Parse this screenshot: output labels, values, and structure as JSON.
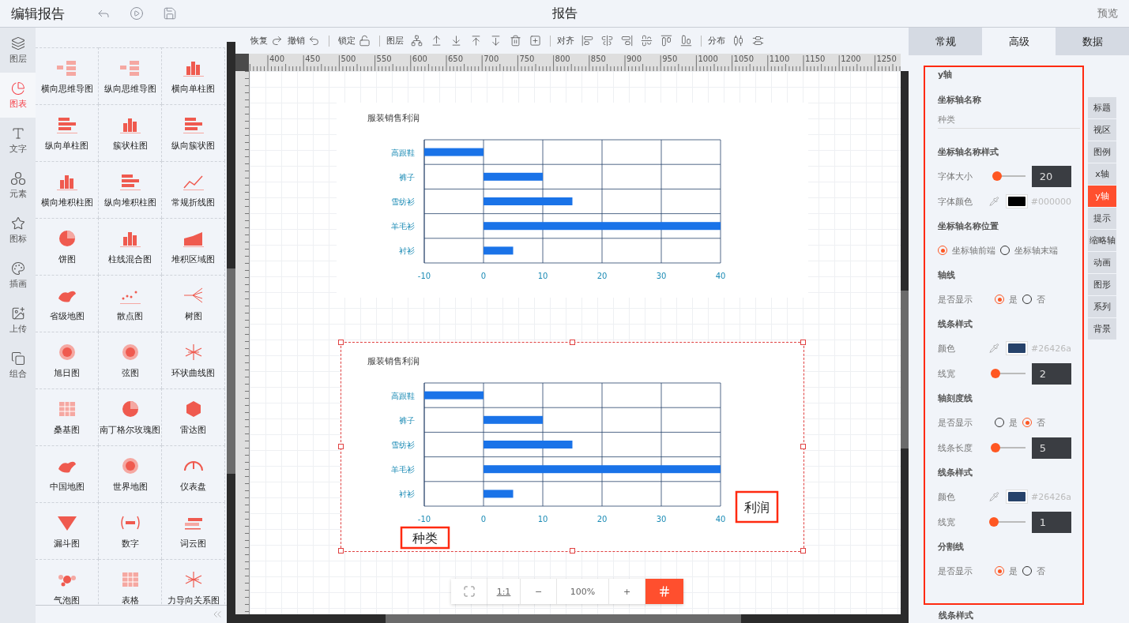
{
  "topbar": {
    "title": "编辑报告",
    "center_title": "报告",
    "preview": "预览"
  },
  "rail": [
    {
      "label": "图层",
      "selected": false
    },
    {
      "label": "图表",
      "selected": true
    },
    {
      "label": "文字",
      "selected": false
    },
    {
      "label": "元素",
      "selected": false
    },
    {
      "label": "图标",
      "selected": false
    },
    {
      "label": "插画",
      "selected": false
    },
    {
      "label": "上传",
      "selected": false
    },
    {
      "label": "组合",
      "selected": false
    }
  ],
  "palette": [
    "横向思维导图",
    "纵向思维导图",
    "横向单柱图",
    "纵向单柱图",
    "簇状柱图",
    "纵向簇状图",
    "横向堆积柱图",
    "纵向堆积柱图",
    "常规折线图",
    "饼图",
    "柱线混合图",
    "堆积区域图",
    "省级地图",
    "散点图",
    "树图",
    "旭日图",
    "弦图",
    "环状曲线图",
    "桑基图",
    "南丁格尔玫瑰图",
    "雷达图",
    "中国地图",
    "世界地图",
    "仪表盘",
    "漏斗图",
    "数字",
    "词云图",
    "气泡图",
    "表格",
    "力导向关系图"
  ],
  "toolbar": [
    {
      "label": "恢复"
    },
    {
      "label": "撤销"
    },
    {
      "label": "锁定"
    },
    {
      "label": "图层"
    },
    {
      "label": "对齐"
    },
    {
      "label": "分布"
    }
  ],
  "ruler": [
    "400",
    "450",
    "500",
    "550",
    "600",
    "650",
    "700",
    "750",
    "800",
    "850",
    "900",
    "950",
    "1000",
    "1050",
    "1100",
    "1150",
    "1200",
    "1250"
  ],
  "charts": [
    {
      "selected": false,
      "chart_data": {
        "type": "bar",
        "orientation": "horizontal",
        "grid": true,
        "title": "服装销售利润",
        "categories": [
          "高跟鞋",
          "裤子",
          "雪纺衫",
          "羊毛衫",
          "衬衫"
        ],
        "series": [
          {
            "color": "#1a73e8",
            "values": [
              -10,
              10,
              15,
              40,
              5
            ]
          }
        ],
        "xlim": [
          -10,
          40
        ],
        "xticks": [
          -10,
          0,
          10,
          20,
          30,
          40
        ]
      }
    },
    {
      "selected": true,
      "axis_names": {
        "category_axis": "种类",
        "value_axis": "利润"
      },
      "chart_data": {
        "type": "bar",
        "orientation": "horizontal",
        "grid": true,
        "title": "服装销售利润",
        "categories": [
          "高跟鞋",
          "裤子",
          "雪纺衫",
          "羊毛衫",
          "衬衫"
        ],
        "series": [
          {
            "color": "#1a73e8",
            "values": [
              -10,
              10,
              15,
              40,
              5
            ]
          }
        ],
        "xlim": [
          -10,
          40
        ],
        "xticks": [
          -10,
          0,
          10,
          20,
          30,
          40
        ]
      }
    }
  ],
  "zoombar": {
    "ratio": "1:1",
    "minus": "−",
    "zoom": "100%",
    "plus": "+"
  },
  "panel_tabs": [
    {
      "label": "常规",
      "selected": false
    },
    {
      "label": "高级",
      "selected": true
    },
    {
      "label": "数据",
      "selected": false
    }
  ],
  "side_tabs": [
    {
      "label": "标题",
      "selected": false
    },
    {
      "label": "视区",
      "selected": false
    },
    {
      "label": "图例",
      "selected": false
    },
    {
      "label": "x轴",
      "selected": false
    },
    {
      "label": "y轴",
      "selected": true
    },
    {
      "label": "提示",
      "selected": false
    },
    {
      "label": "缩略轴",
      "selected": false
    },
    {
      "label": "动画",
      "selected": false
    },
    {
      "label": "图形",
      "selected": false
    },
    {
      "label": "系列",
      "selected": false
    },
    {
      "label": "背景",
      "selected": false
    }
  ],
  "settings": {
    "heading": "y轴",
    "sections": [
      {
        "title": "坐标轴名称",
        "rows": [
          {
            "kind": "input",
            "value": "种类"
          }
        ]
      },
      {
        "title": "坐标轴名称样式",
        "rows": [
          {
            "kind": "slider",
            "label": "字体大小",
            "level": 0.15,
            "value": "20"
          },
          {
            "kind": "color",
            "label": "字体颜色",
            "color": "#000000",
            "value": "#000000"
          }
        ]
      },
      {
        "title": "坐标轴名称位置",
        "rows": [
          {
            "kind": "radio",
            "options": [
              {
                "label": "坐标轴前端",
                "selected": true
              },
              {
                "label": "坐标轴末端",
                "selected": false
              }
            ]
          }
        ]
      },
      {
        "title": "轴线",
        "rows": [
          {
            "kind": "radio",
            "label": "是否显示",
            "options": [
              {
                "label": "是",
                "selected": true
              },
              {
                "label": "否",
                "selected": false
              }
            ]
          }
        ]
      },
      {
        "title": "线条样式",
        "rows": [
          {
            "kind": "color",
            "label": "颜色",
            "color": "#26426a",
            "value": "#26426a"
          },
          {
            "kind": "slider",
            "label": "线宽",
            "level": 0.1,
            "value": "2"
          }
        ]
      },
      {
        "title": "轴刻度线",
        "rows": [
          {
            "kind": "radio",
            "label": "是否显示",
            "options": [
              {
                "label": "是",
                "selected": false
              },
              {
                "label": "否",
                "selected": true
              }
            ]
          },
          {
            "kind": "slider",
            "label": "线条长度",
            "level": 0.1,
            "value": "5"
          }
        ]
      },
      {
        "title": "线条样式",
        "rows": [
          {
            "kind": "color",
            "label": "颜色",
            "color": "#26426a",
            "value": "#26426a"
          },
          {
            "kind": "slider",
            "label": "线宽",
            "level": 0.05,
            "value": "1"
          }
        ]
      },
      {
        "title": "分割线",
        "rows": [
          {
            "kind": "radio",
            "label": "是否显示",
            "options": [
              {
                "label": "是",
                "selected": true
              },
              {
                "label": "否",
                "selected": false
              }
            ]
          }
        ]
      }
    ],
    "tail": "线条样式"
  }
}
